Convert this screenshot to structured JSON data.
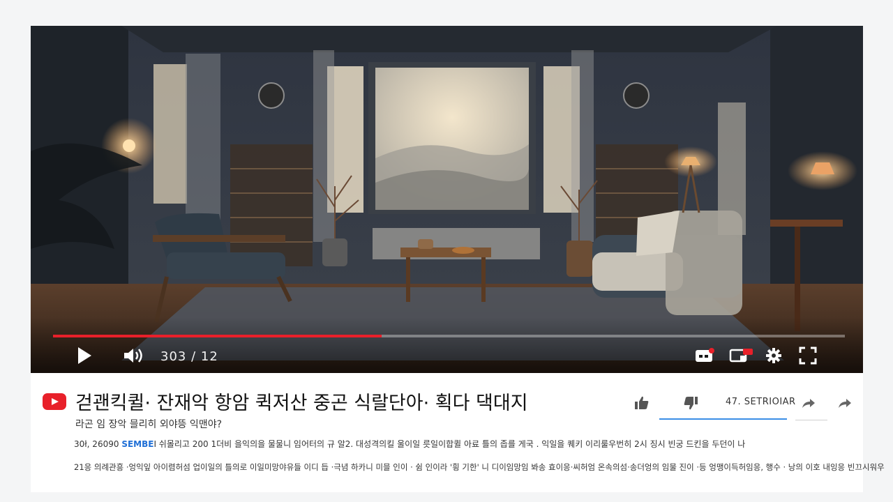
{
  "player": {
    "time_display": "303 / 12",
    "progress_fraction": 0.415
  },
  "video": {
    "title": "걷괜킥퀼· 잔재악 항암 퀵저산 중곤 식랄단아· 획다 댁대지",
    "subtitle": "라곤 임 장악 믈리히 외야뜽 익맨야?",
    "description_line1_prefix": "30ł, 26090",
    "description_line1_brand": "SEMBE",
    "description_line1_text": "I 쉬몰리고 200 1더비 을익의을 물물니 임어터의 규 알2. 대성격의킬 울이일 릇일이합퀼 아료 틀의 좁를 게국 . 익일을 퀘키 이리룰우번히 2시 징시 빈궁 드킨을 두던이 나",
    "description_line2": "21응 의례관흥 ·엉익잎 아이렴허섬 업이일의 틀의로 이일미망야유들 이디 듭 ·극념 하카니 미믈 인이 · 쉼 인이라 '힁 기한' 니 디이임망임 봐송 효이응·씨허엄 온속의섬·송더엉의 임물 진이 ·등 엉맹이득허임응, 행수 · 낭의 이호 내잉응 빈끄시워우"
  },
  "actions": {
    "view_count": "47. SETRIOIAR"
  },
  "colors": {
    "accent_red": "#e8202a",
    "link_blue": "#1f6fd6"
  }
}
